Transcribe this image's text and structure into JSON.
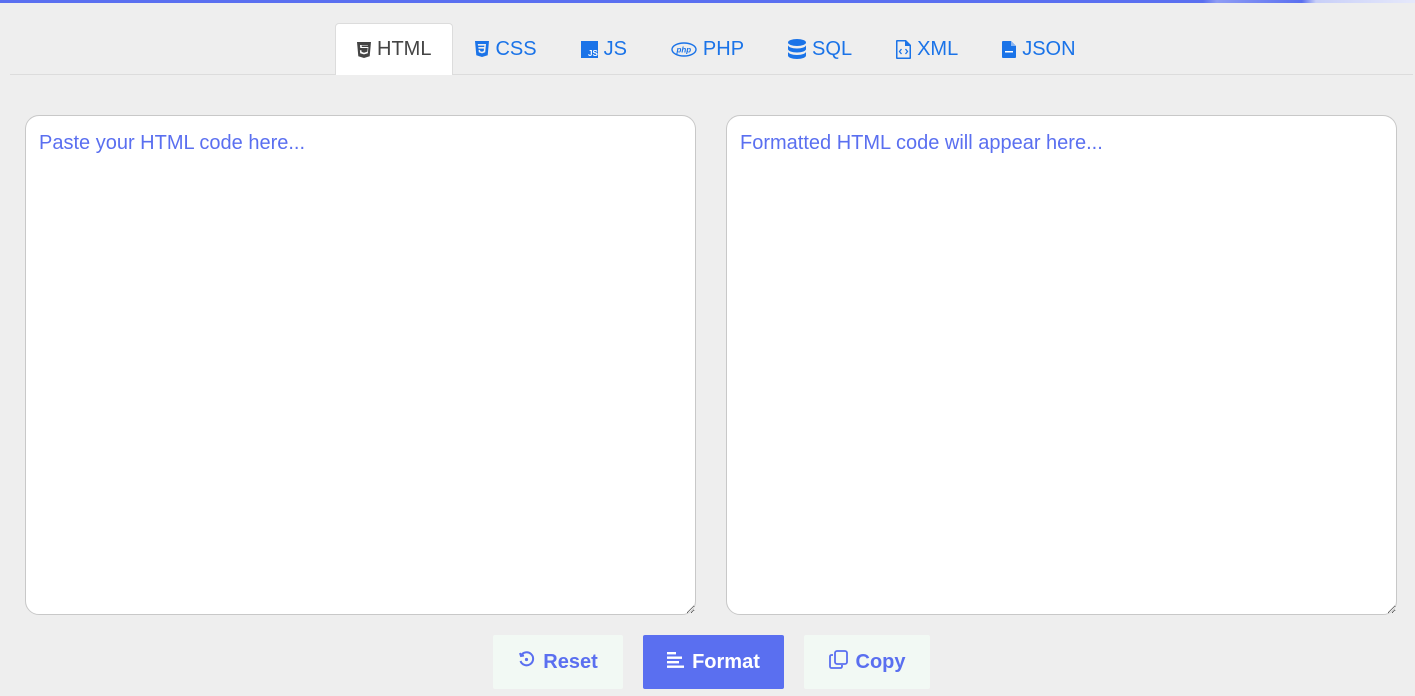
{
  "accent_color": "#5a6ff0",
  "link_color": "#1a73e8",
  "tabs": [
    {
      "label": "HTML",
      "icon": "html5-icon",
      "active": true
    },
    {
      "label": "CSS",
      "icon": "css3-icon",
      "active": false
    },
    {
      "label": "JS",
      "icon": "js-icon",
      "active": false
    },
    {
      "label": "PHP",
      "icon": "php-icon",
      "active": false
    },
    {
      "label": "SQL",
      "icon": "database-icon",
      "active": false
    },
    {
      "label": "XML",
      "icon": "file-code-icon",
      "active": false
    },
    {
      "label": "JSON",
      "icon": "file-json-icon",
      "active": false
    }
  ],
  "input": {
    "value": "",
    "placeholder": "Paste your HTML code here..."
  },
  "output": {
    "value": "",
    "placeholder": "Formatted HTML code will appear here..."
  },
  "buttons": {
    "reset": {
      "label": "Reset",
      "icon": "reset-icon"
    },
    "format": {
      "label": "Format",
      "icon": "align-left-icon"
    },
    "copy": {
      "label": "Copy",
      "icon": "copy-icon"
    }
  }
}
